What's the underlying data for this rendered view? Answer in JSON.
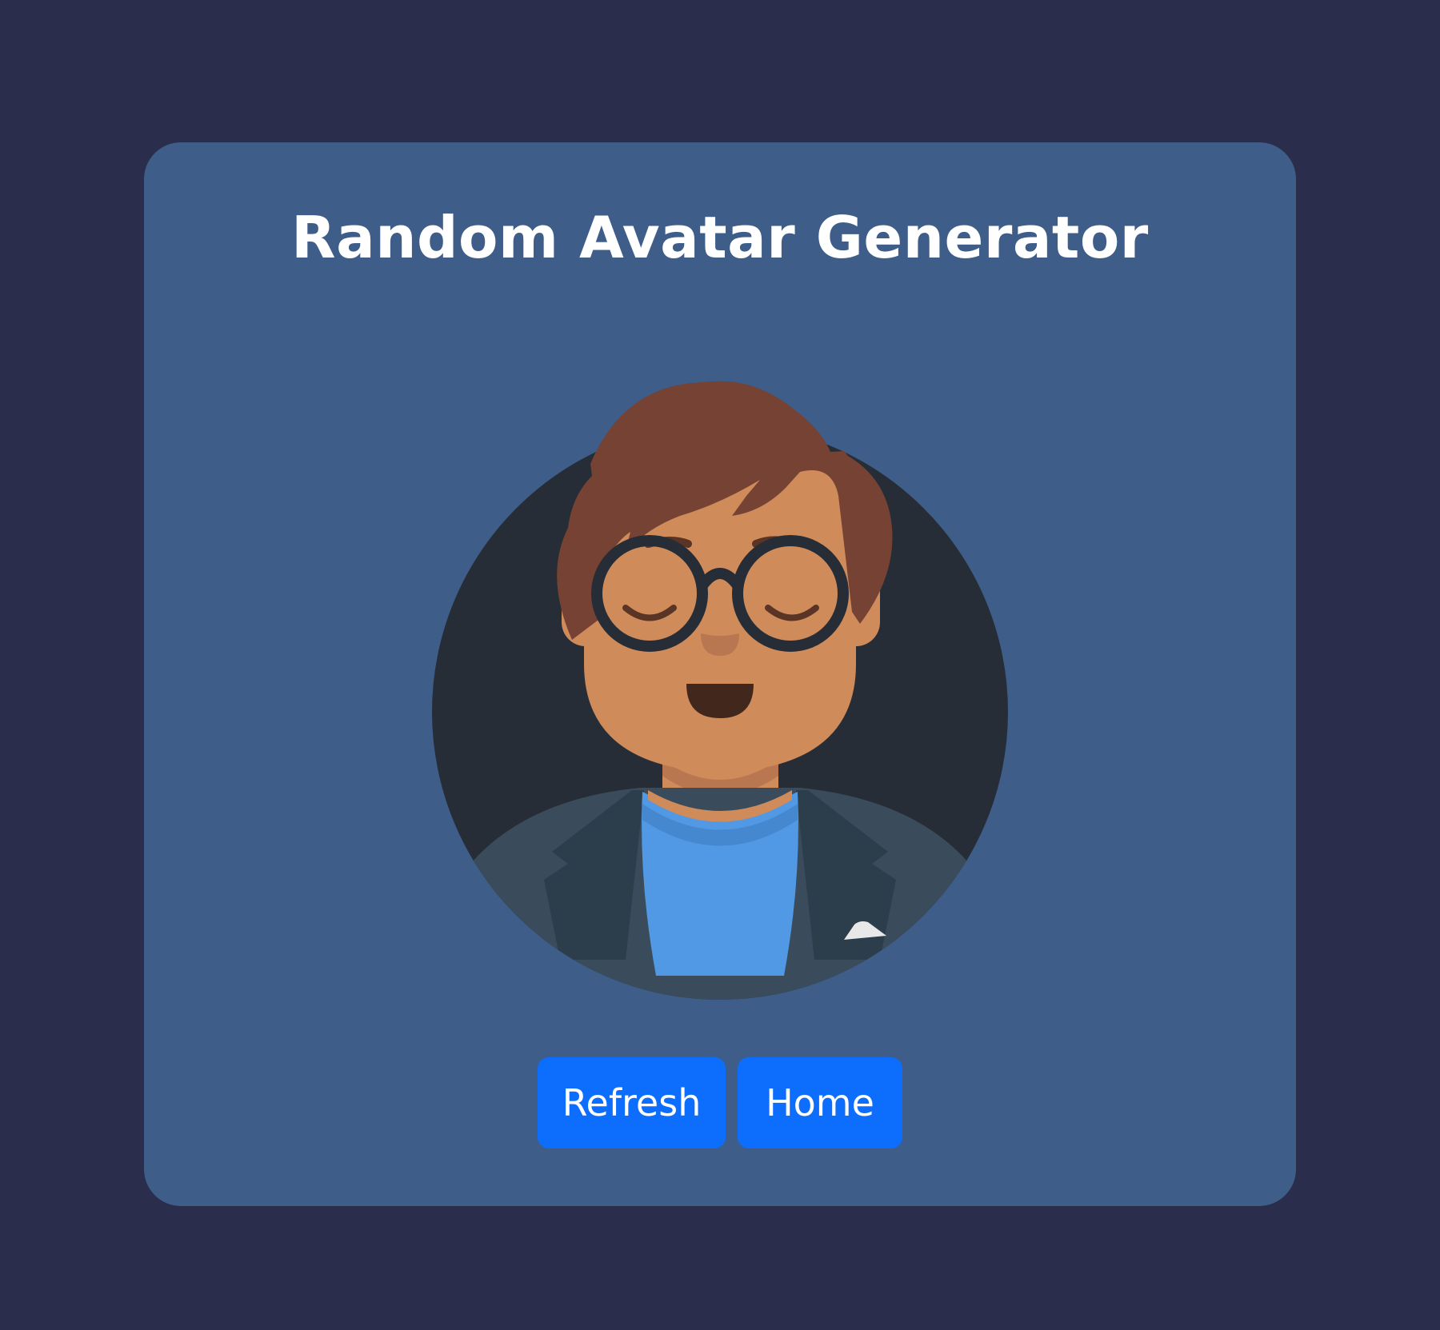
{
  "page": {
    "title": "Random Avatar Generator"
  },
  "avatar": {
    "background_color": "#262d36",
    "skin_color": "#d08b5b",
    "hair_color": "#754234",
    "glasses_color": "#262d36",
    "shirt_color": "#5199e4",
    "jacket_color": "#3a4c5b",
    "eyes": "closed-happy",
    "mouth": "open-smile"
  },
  "actions": {
    "refresh_label": "Refresh",
    "home_label": "Home"
  },
  "colors": {
    "page_background": "#2a2d4b",
    "card_background": "#3e5d88",
    "button_background": "#0d6efd",
    "text": "#ffffff"
  }
}
